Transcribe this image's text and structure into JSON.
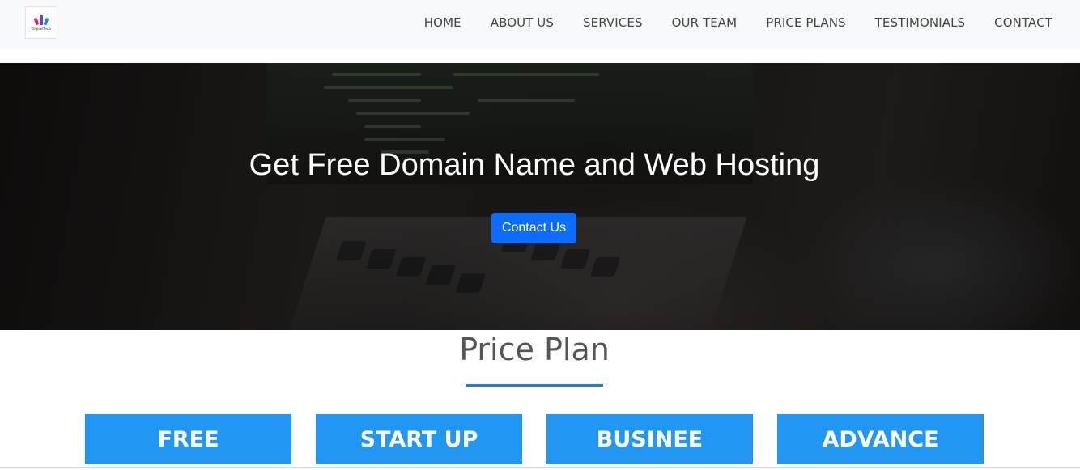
{
  "brand": {
    "logo_text": "DigitalTech"
  },
  "nav": {
    "items": [
      {
        "label": "HOME"
      },
      {
        "label": "ABOUT US"
      },
      {
        "label": "SERVICES"
      },
      {
        "label": "OUR TEAM"
      },
      {
        "label": "PRICE PLANS"
      },
      {
        "label": "TESTIMONIALS"
      },
      {
        "label": "CONTACT"
      }
    ]
  },
  "hero": {
    "title": "Get Free Domain Name and Web Hosting",
    "button_label": "Contact Us"
  },
  "price_section": {
    "title": "Price Plan",
    "plans": [
      {
        "name": "FREE"
      },
      {
        "name": "START UP"
      },
      {
        "name": "BUSINEE"
      },
      {
        "name": "ADVANCE"
      }
    ]
  },
  "colors": {
    "primary_button": "#0d6efd",
    "plan_header": "#2196f3",
    "underline": "#1e7be0"
  }
}
